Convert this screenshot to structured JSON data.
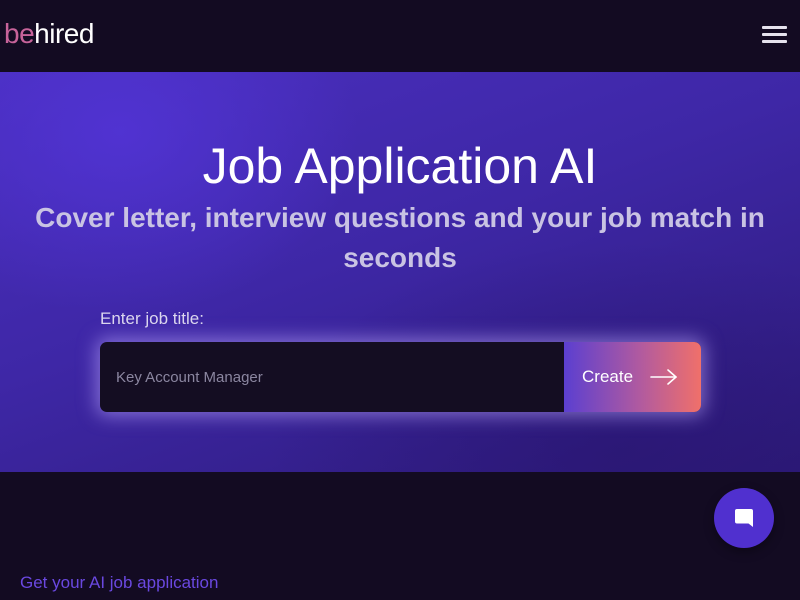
{
  "header": {
    "logo_prefix": "be",
    "logo_suffix": "hired",
    "menu_icon": "hamburger-menu-icon"
  },
  "hero": {
    "title": "Job Application AI",
    "subtitle": "Cover letter, interview questions and your job match in seconds",
    "field_label": "Enter job title:",
    "input_placeholder": "Key Account Manager",
    "input_value": "",
    "create_label": "Create",
    "create_icon": "arrow-right-icon"
  },
  "footer_section": {
    "link_text": "Get your AI job application"
  },
  "chat": {
    "icon": "chat-bubble-icon"
  },
  "colors": {
    "logo_accent": "#c7639a",
    "hero_bg": "#4a2fbf",
    "page_bg": "#130b22",
    "button_gradient_start": "#5b3fd0",
    "button_gradient_end": "#f0706a",
    "link": "#6a48e0",
    "chat_button": "#5030cf"
  }
}
